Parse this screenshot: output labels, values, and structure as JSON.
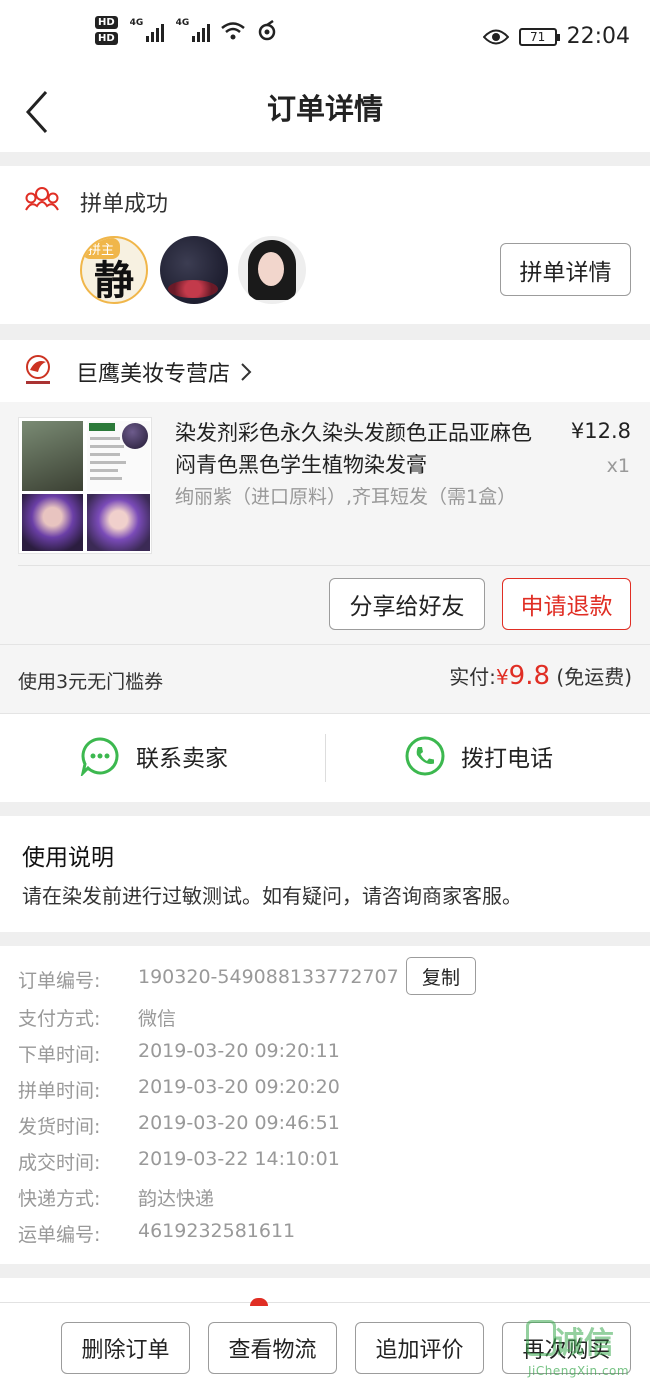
{
  "status_bar": {
    "hd1": "HD",
    "hd2": "HD",
    "net1": "4G",
    "net2": "4G",
    "battery": "71",
    "time": "22:04"
  },
  "header": {
    "title": "订单详情"
  },
  "group": {
    "status": "拼单成功",
    "leader_tag": "拼主",
    "leader_glyph": "静",
    "detail_button": "拼单详情"
  },
  "shop": {
    "name": "巨鹰美妆专营店"
  },
  "product": {
    "name": "染发剂彩色永久染头发颜色正品亚麻色闷青色黑色学生植物染发膏",
    "price": "¥12.8",
    "quantity": "x1",
    "spec": "绚丽紫（进口原料）,齐耳短发（需1盒）",
    "share_button": "分享给好友",
    "refund_button": "申请退款"
  },
  "payment": {
    "coupon": "使用3元无门槛券",
    "paid_label": "实付:",
    "currency": "¥",
    "amount": "9.8",
    "shipping_note": "(免运费)"
  },
  "contact": {
    "chat_label": "联系卖家",
    "call_label": "拨打电话"
  },
  "usage": {
    "title": "使用说明",
    "text": "请在染发前进行过敏测试。如有疑问，请咨询商家客服。"
  },
  "order_info": {
    "copy_button": "复制",
    "rows": [
      {
        "label": "订单编号:",
        "value": "190320-549088133772707"
      },
      {
        "label": "支付方式:",
        "value": "微信"
      },
      {
        "label": "下单时间:",
        "value": "2019-03-20 09:20:11"
      },
      {
        "label": "拼单时间:",
        "value": "2019-03-20 09:20:20"
      },
      {
        "label": "发货时间:",
        "value": "2019-03-20 09:46:51"
      },
      {
        "label": "成交时间:",
        "value": "2019-03-22 14:10:01"
      },
      {
        "label": "快递方式:",
        "value": "韵达快递"
      },
      {
        "label": "运单编号:",
        "value": "4619232581611"
      }
    ]
  },
  "bottom_bar": {
    "delete": "删除订单",
    "logistics": "查看物流",
    "review": "追加评价",
    "rebuy": "再次购买"
  },
  "watermark": {
    "main": "诚信",
    "sub": "JiChengXin.com"
  },
  "colors": {
    "accent_red": "#e02e24",
    "wechat_green": "#3cb84f"
  }
}
